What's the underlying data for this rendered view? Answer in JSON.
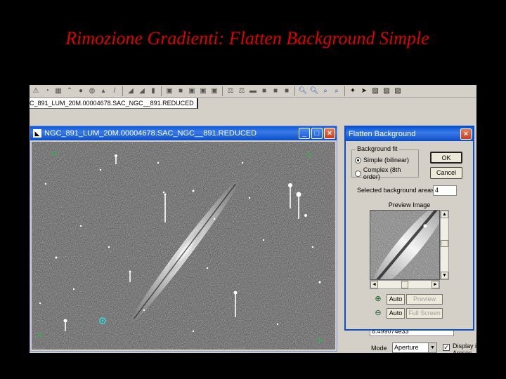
{
  "slide": {
    "title": "Rimozione Gradienti: Flatten Background Simple"
  },
  "colors": {
    "title_red": "#e00000",
    "xp_blue": "#0a58d8",
    "window_bg": "#d4d0c8"
  },
  "toolbar": {
    "icons": [
      "warning-icon",
      "pie-icon",
      "grid-icon",
      "chevron-up-icon",
      "circle-icon",
      "globe-icon",
      "chart-icon",
      "slash-icon",
      "ramp-icon",
      "ramp-icon",
      "bars-icon",
      "bracket-icon",
      "rect-icon",
      "bracket-icon",
      "bracket-icon",
      "bracket-icon",
      "balance-icon",
      "balance-icon",
      "minus-icon",
      "rect-icon",
      "rect-icon",
      "rect-icon",
      "zoom-in-icon",
      "zoom-in-icon",
      "zoom-icon",
      "zoom-icon",
      "tool-icon",
      "arrow-icon",
      "image-icon",
      "image-icon",
      "image-icon"
    ]
  },
  "document_tab": {
    "label": "C_891_LUM_20M.00004678.SAC_NGC__891.REDUCED"
  },
  "image_window": {
    "title": "NGC_891_LUM_20M.00004678.SAC_NGC__891.REDUCED"
  },
  "dialog": {
    "title": "Flatten Background",
    "group_label": "Background fit",
    "options": [
      {
        "label": "Simple (bilinear)",
        "checked": true
      },
      {
        "label": "Complex (8th order)",
        "checked": false
      }
    ],
    "ok_label": "OK",
    "cancel_label": "Cancel",
    "areas_label": "Selected background areas",
    "areas_value": "4",
    "preview_label": "Preview Image",
    "auto_label_1": "Auto",
    "preview_button": "Preview",
    "auto_label_2": "Auto",
    "full_screen_button": "Full Screen"
  },
  "side_panel": {
    "value": "8.499074e33",
    "mode_label": "Mode",
    "mode_value": "Aperture",
    "display_label": "Display in Arcsec"
  }
}
